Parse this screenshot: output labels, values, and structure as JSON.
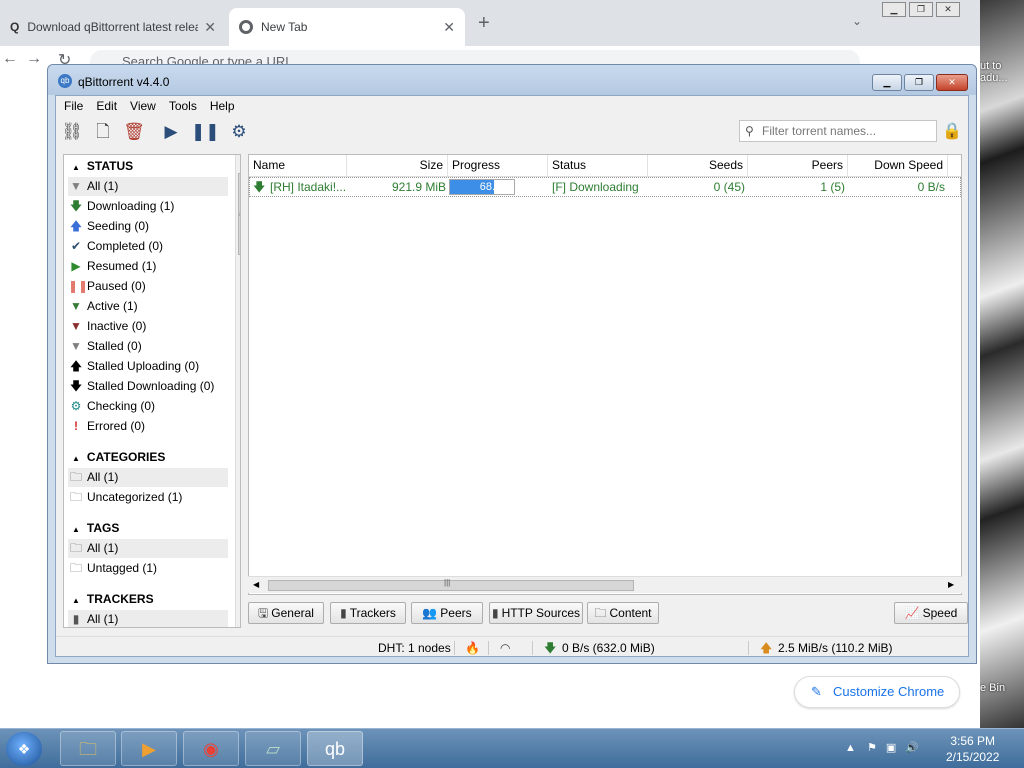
{
  "chrome": {
    "tabs": [
      {
        "title": "Download qBittorrent latest relea"
      },
      {
        "title": "New Tab"
      }
    ],
    "omnibox_placeholder": "Search Google or type a URL",
    "customize_label": "Customize Chrome"
  },
  "desktop": {
    "label_top": "ut to\nadu...",
    "label_bottom": "e Bin"
  },
  "app": {
    "title": "qBittorrent v4.4.0",
    "menu": [
      "File",
      "Edit",
      "View",
      "Tools",
      "Help"
    ],
    "search_placeholder": "Filter torrent names...",
    "sidebar": {
      "status_header": "STATUS",
      "status_items": [
        {
          "label": "All (1)",
          "icon": "funnel-icon",
          "color": "#808080"
        },
        {
          "label": "Downloading (1)",
          "icon": "arrow-down-icon",
          "color": "#2e7d32"
        },
        {
          "label": "Seeding (0)",
          "icon": "arrow-up-icon",
          "color": "#3a6fd8"
        },
        {
          "label": "Completed (0)",
          "icon": "checkmark-icon",
          "color": "#2d4f6e"
        },
        {
          "label": "Resumed (1)",
          "icon": "play-icon",
          "color": "#2e8b2e"
        },
        {
          "label": "Paused (0)",
          "icon": "pause-icon",
          "color": "#e27a6e"
        },
        {
          "label": "Active (1)",
          "icon": "funnel-icon",
          "color": "#3a7d3a"
        },
        {
          "label": "Inactive (0)",
          "icon": "funnel-icon",
          "color": "#8b2e2e"
        },
        {
          "label": "Stalled (0)",
          "icon": "funnel-icon",
          "color": "#808080"
        },
        {
          "label": "Stalled Uploading (0)",
          "icon": "arrow-up-icon",
          "color": "#000000"
        },
        {
          "label": "Stalled Downloading (0)",
          "icon": "arrow-down-icon",
          "color": "#000000"
        },
        {
          "label": "Checking (0)",
          "icon": "gear-icon",
          "color": "#1d8a8a"
        },
        {
          "label": "Errored (0)",
          "icon": "exclamation-icon",
          "color": "#d32f2f"
        }
      ],
      "categories_header": "CATEGORIES",
      "category_items": [
        {
          "label": "All (1)"
        },
        {
          "label": "Uncategorized (1)"
        }
      ],
      "tags_header": "TAGS",
      "tag_items": [
        {
          "label": "All (1)"
        },
        {
          "label": "Untagged (1)"
        }
      ],
      "trackers_header": "TRACKERS",
      "tracker_items": [
        {
          "label": "All (1)"
        }
      ]
    },
    "table": {
      "columns": [
        "Name",
        "Size",
        "Progress",
        "Status",
        "Seeds",
        "Peers",
        "Down Speed"
      ],
      "rows": [
        {
          "name": "[RH] Itadaki!...",
          "size": "921.9 MiB",
          "progress": 0.685,
          "progress_text": "68.5%",
          "status": "[F] Downloading",
          "seeds": "0 (45)",
          "peers": "1 (5)",
          "down_speed": "0 B/s"
        }
      ]
    },
    "bottom_tabs": [
      "General",
      "Trackers",
      "Peers",
      "HTTP Sources",
      "Content"
    ],
    "speed_label": "Speed",
    "statusbar": {
      "dht": "DHT: 1 nodes",
      "download": "0 B/s (632.0 MiB)",
      "upload": "2.5 MiB/s (110.2 MiB)"
    }
  },
  "taskbar": {
    "time": "3:56 PM",
    "date": "2/15/2022"
  },
  "colors": {
    "progress_fill": "#3d8ee6",
    "downloading_text": "#2e7d32",
    "taskbar": "#4f7dab"
  }
}
